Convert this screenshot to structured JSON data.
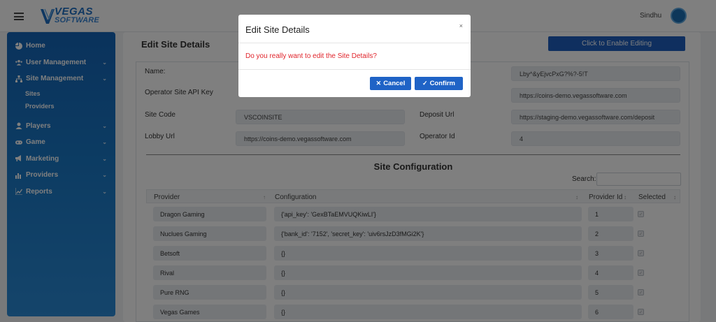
{
  "header": {
    "logo_line1": "VEGAS",
    "logo_line2": "SOFTWARE",
    "username": "Sindhu"
  },
  "sidebar": {
    "items": [
      {
        "label": "Home",
        "icon": "pie-chart-icon"
      },
      {
        "label": "User Management",
        "icon": "users-icon"
      },
      {
        "label": "Site Management",
        "icon": "sitemap-icon"
      },
      {
        "label": "Players",
        "icon": "user-icon"
      },
      {
        "label": "Game",
        "icon": "gamepad-icon"
      },
      {
        "label": "Marketing",
        "icon": "bullhorn-icon"
      },
      {
        "label": "Providers",
        "icon": "chart-bar-icon"
      },
      {
        "label": "Reports",
        "icon": "chart-line-icon"
      }
    ],
    "subitems": [
      {
        "label": "Sites"
      },
      {
        "label": "Providers"
      }
    ]
  },
  "main": {
    "title": "Edit Site Details",
    "enable_button": "Click to Enable Editing",
    "fields": {
      "name_label": "Name:",
      "api_key_label": "Operator Site API Key",
      "site_code_label": "Site Code",
      "site_code_value": "VSCOINSITE",
      "lobby_url_label": "Lobby Url",
      "lobby_url_value": "https://coins-demo.vegassoftware.com",
      "right1_value": "Lby^&yEjvcPxG?%?-5!T",
      "right2_value": "https://coins-demo.vegassoftware.com",
      "deposit_url_label": "Deposit Url",
      "deposit_url_value": "https://staging-demo.vegassoftware.com/deposit",
      "operator_id_label": "Operator Id",
      "operator_id_value": "4"
    },
    "site_config_title": "Site Configuration",
    "search_label": "Search:",
    "table": {
      "headers": [
        "Provider",
        "Configuration",
        "Provider Id",
        "Selected"
      ],
      "rows": [
        {
          "provider": "Dragon Gaming",
          "config": "{'api_key': 'GexBTaEMVUQKiwLI'}",
          "id": "1"
        },
        {
          "provider": "Nuclues Gaming",
          "config": "{'bank_id': '7152', 'secret_key': 'uiv6rsJzD3fMGi2K'}",
          "id": "2"
        },
        {
          "provider": "Betsoft",
          "config": "{}",
          "id": "3"
        },
        {
          "provider": "Rival",
          "config": "{}",
          "id": "4"
        },
        {
          "provider": "Pure RNG",
          "config": "{}",
          "id": "5"
        },
        {
          "provider": "Vegas Games",
          "config": "{}",
          "id": "6"
        }
      ]
    }
  },
  "modal": {
    "title": "Edit Site Details",
    "close": "×",
    "message": "Do you really want to edit the Site Details?",
    "cancel_label": "Cancel",
    "confirm_label": "Confirm"
  },
  "colors": {
    "sidebar": "#1565b8",
    "primary_button": "#1f63c6",
    "warning_text": "#e0242b"
  }
}
